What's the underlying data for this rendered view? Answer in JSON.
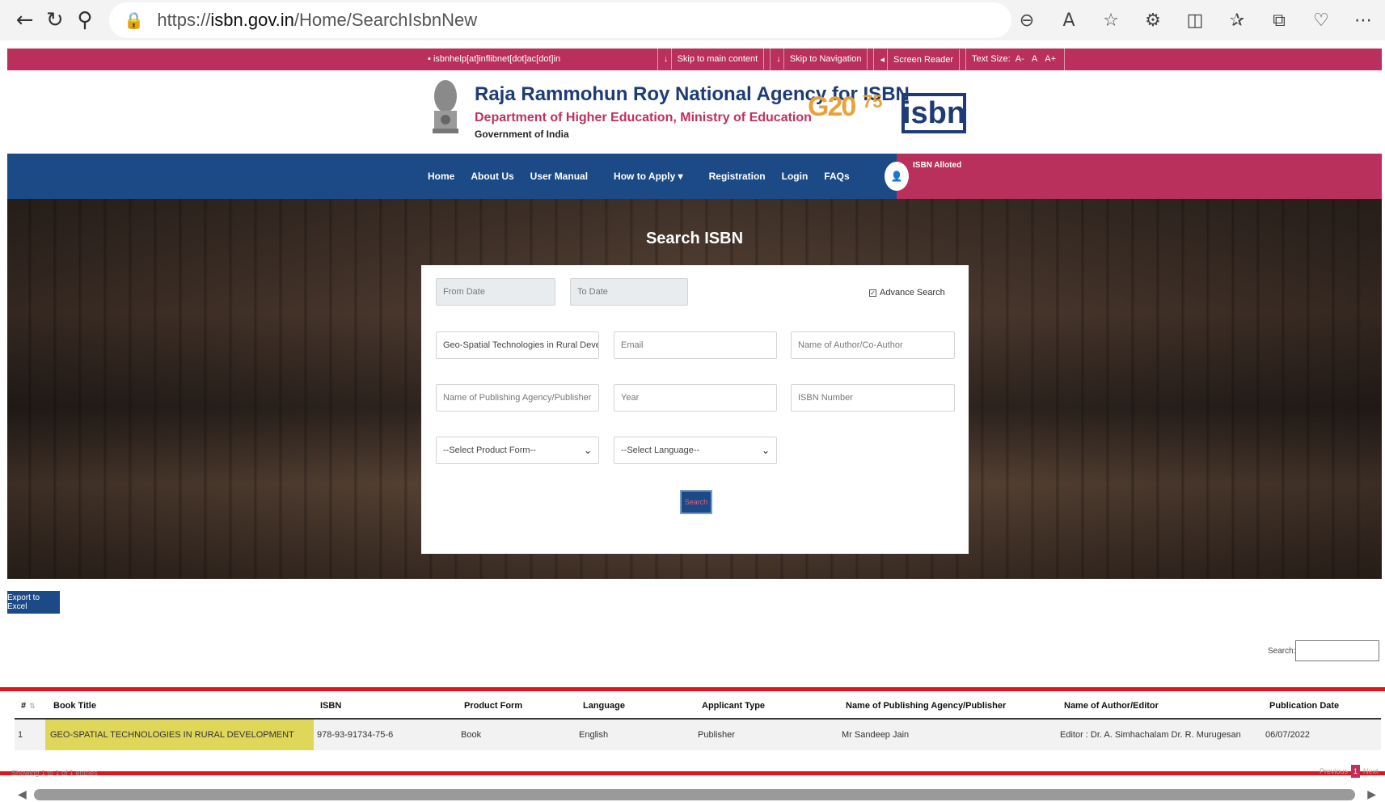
{
  "browser": {
    "url_prefix": "https://",
    "url_domain": "isbn.gov.in",
    "url_path": "/Home/SearchIsbnNew"
  },
  "util_bar": {
    "email": "isbnhelp[at]inflibnet[dot]ac[dot]in",
    "skip_main": "Skip to main content",
    "skip_nav": "Skip to Navigation",
    "screen_reader": "Screen Reader",
    "text_size": "Text Size:",
    "size_minus": "A-",
    "size_normal": "A",
    "size_plus": "A+"
  },
  "header": {
    "org_name": "Raja Rammohun Roy National Agency for ISBN",
    "department": "Department of Higher Education, Ministry of Education",
    "government": "Government of India",
    "g20": "G20",
    "azadi": "75",
    "isbn_logo": "isbn"
  },
  "nav": {
    "items": [
      "Home",
      "About Us",
      "User Manual",
      "How to Apply ▾",
      "Registration",
      "Login",
      "FAQs"
    ],
    "isbn_alloted": "ISBN Alloted"
  },
  "search": {
    "title": "Search ISBN",
    "from_date_ph": "From Date",
    "to_date_ph": "To Date",
    "advance_search": "Advance Search",
    "book_title_value": "Geo-Spatial Technologies in Rural Deve",
    "email_ph": "Email",
    "author_ph": "Name of Author/Co-Author",
    "publisher_ph": "Name of Publishing Agency/Publisher",
    "year_ph": "Year",
    "isbn_ph": "ISBN Number",
    "product_form": "--Select Product Form--",
    "language": "--Select Language--",
    "search_btn": "Search"
  },
  "results": {
    "export_btn": "Export to Excel",
    "search_label": "Search:",
    "columns": [
      "#",
      "Book Title",
      "ISBN",
      "Product Form",
      "Language",
      "Applicant Type",
      "Name of Publishing Agency/Publisher",
      "Name of Author/Editor",
      "Publication Date"
    ],
    "rows": [
      {
        "num": "1",
        "title": "GEO-SPATIAL TECHNOLOGIES IN RURAL DEVELOPMENT",
        "isbn": "978-93-91734-75-6",
        "product_form": "Book",
        "language": "English",
        "applicant_type": "Publisher",
        "publisher": "Mr Sandeep Jain",
        "author": "Editor : Dr. A. Simhachalam Dr. R. Murugesan",
        "date": "06/07/2022"
      }
    ],
    "showing": "Showing 1 to 1 of 1 entries",
    "prev": "Previous",
    "page": "1",
    "next": "Next"
  }
}
